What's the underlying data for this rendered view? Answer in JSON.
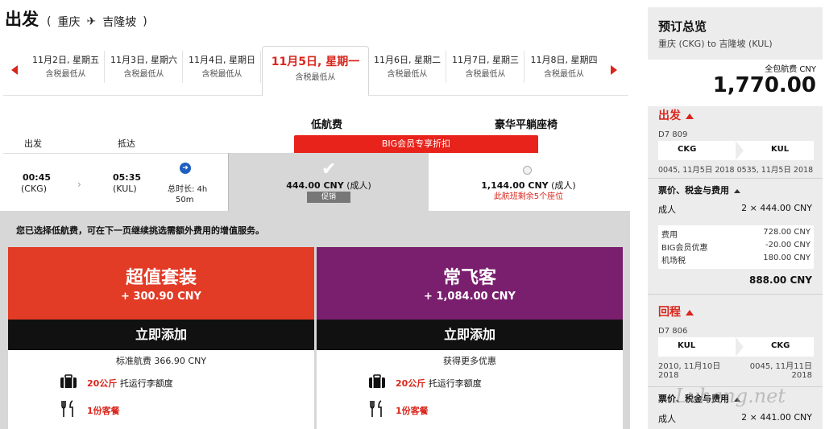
{
  "header": {
    "title": "出发",
    "origin": "重庆",
    "destination": "吉隆坡",
    "plane_glyph": "✈"
  },
  "dates": {
    "items": [
      {
        "date": "11月2日, 星期五",
        "sub": "含税最低从"
      },
      {
        "date": "11月3日, 星期六",
        "sub": "含税最低从"
      },
      {
        "date": "11月4日, 星期日",
        "sub": "含税最低从"
      },
      {
        "date": "11月5日, 星期一",
        "sub": "含税最低从"
      },
      {
        "date": "11月6日, 星期二",
        "sub": "含税最低从"
      },
      {
        "date": "11月7日, 星期三",
        "sub": "含税最低从"
      },
      {
        "date": "11月8日, 星期四",
        "sub": "含税最低从"
      }
    ]
  },
  "fare_columns": {
    "low": "低航费",
    "lux": "豪华平躺座椅",
    "big_banner": "BIG会员专享折扣"
  },
  "table_headers": {
    "depart": "出发",
    "arrive": "抵达"
  },
  "flight": {
    "dep_time": "00:45",
    "dep_code": "(CKG)",
    "arr_time": "05:35",
    "arr_code": "(KUL)",
    "duration_label": "总时长: 4h",
    "duration_min": "50m",
    "low_price": "444.00 CNY",
    "low_suffix": "(成人)",
    "promo": "促销",
    "lux_price": "1,144.00 CNY",
    "lux_suffix": "(成人)",
    "seats_left": "此航班剩余5个座位"
  },
  "extras": {
    "note": "您已选择低航费，可在下一页继续挑选需额外费用的增值服务。",
    "cards": [
      {
        "name": "超值套装",
        "price": "+ 300.90 CNY",
        "add": "立即添加",
        "sub": "标准航费 366.90 CNY",
        "color": "#e23b26",
        "perks": [
          {
            "icon": "luggage-icon",
            "glyph": "🧳",
            "hl": "20公斤",
            "text": "托运行李额度"
          },
          {
            "icon": "meal-icon",
            "glyph": "🍴",
            "hl": "1份客餐",
            "text": ""
          }
        ]
      },
      {
        "name": "常飞客",
        "price": "+ 1,084.00 CNY",
        "add": "立即添加",
        "sub": "获得更多优惠",
        "color": "#7a1f6e",
        "perks": [
          {
            "icon": "luggage-icon",
            "glyph": "🧳",
            "hl": "20公斤",
            "text": "托运行李额度"
          },
          {
            "icon": "meal-icon",
            "glyph": "🍴",
            "hl": "1份客餐",
            "text": ""
          }
        ]
      }
    ]
  },
  "summary": {
    "title": "预订总览",
    "route": "重庆 (CKG) to 吉隆坡 (KUL)",
    "total_label": "全包航费 CNY",
    "total_amount": "1,770.00",
    "outbound": {
      "head": "出发",
      "flight_no": "D7 809",
      "from": "CKG",
      "to": "KUL",
      "times": "0045, 11月5日 2018 0535, 11月5日 2018",
      "fare_head": "票价、税金与费用",
      "pax_label": "成人",
      "pax_value": "2 × 444.00 CNY",
      "fees": [
        {
          "label": "费用",
          "value": "728.00 CNY"
        },
        {
          "label": "BIG会员优惠",
          "value": "-20.00 CNY"
        },
        {
          "label": "机场税",
          "value": "180.00 CNY"
        }
      ],
      "subtotal": "888.00 CNY"
    },
    "inbound": {
      "head": "回程",
      "flight_no": "D7 806",
      "from": "KUL",
      "to": "CKG",
      "time_left": "2010, 11月10日",
      "time_left2": "2018",
      "time_right": "0045, 11月11日",
      "time_right2": "2018",
      "fare_head": "票价、税金与费用",
      "pax_label": "成人",
      "pax_value": "2 × 441.00 CNY"
    }
  },
  "watermark": "Lvhang.net",
  "colors": {
    "accent_red": "#d9261c",
    "purple": "#7a1f6e",
    "orange_red": "#e23b26"
  }
}
